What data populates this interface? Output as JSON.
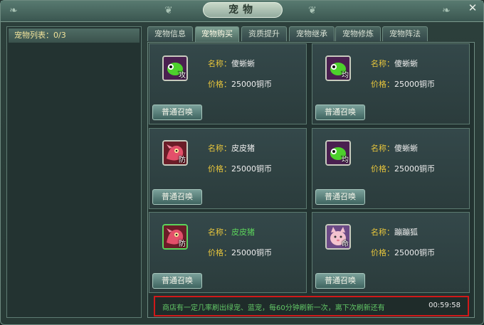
{
  "window": {
    "title": "宠物"
  },
  "left_panel": {
    "header_label": "宠物列表：",
    "count": "0/3"
  },
  "tabs": [
    {
      "label": "宠物信息",
      "active": false
    },
    {
      "label": "宠物购买",
      "active": true
    },
    {
      "label": "资质提升",
      "active": false
    },
    {
      "label": "宠物继承",
      "active": false
    },
    {
      "label": "宠物修炼",
      "active": false
    },
    {
      "label": "宠物阵法",
      "active": false
    }
  ],
  "shop": {
    "name_label": "名称：",
    "price_label": "价格：",
    "summon_label": "普通召唤",
    "items": [
      {
        "name": "傻蜥蜥",
        "price": "25000铜币",
        "tag": "攻",
        "icon": "green-lizard-icon",
        "name_green": false
      },
      {
        "name": "傻蜥蜥",
        "price": "25000铜币",
        "tag": "均",
        "icon": "green-lizard-icon",
        "name_green": false
      },
      {
        "name": "皮皮猪",
        "price": "25000铜币",
        "tag": "防",
        "icon": "red-pig-icon",
        "name_green": false
      },
      {
        "name": "傻蜥蜥",
        "price": "25000铜币",
        "tag": "均",
        "icon": "green-lizard-icon",
        "name_green": false
      },
      {
        "name": "皮皮猪",
        "price": "25000铜币",
        "tag": "防",
        "icon": "red-pig-icon",
        "name_green": true
      },
      {
        "name": "蹦蹦狐",
        "price": "25000铜币",
        "tag": "命",
        "icon": "pink-fox-icon",
        "name_green": false
      }
    ]
  },
  "notice": {
    "text": "商店有一定几率刷出绿宠、蓝宠，每60分钟刷新一次，离下次刷新还有",
    "timer": "00:59:58"
  },
  "colors": {
    "accent_gold": "#e8c63c",
    "notice_border": "#d01919",
    "notice_text": "#62c766",
    "green_name": "#5bd45b"
  }
}
